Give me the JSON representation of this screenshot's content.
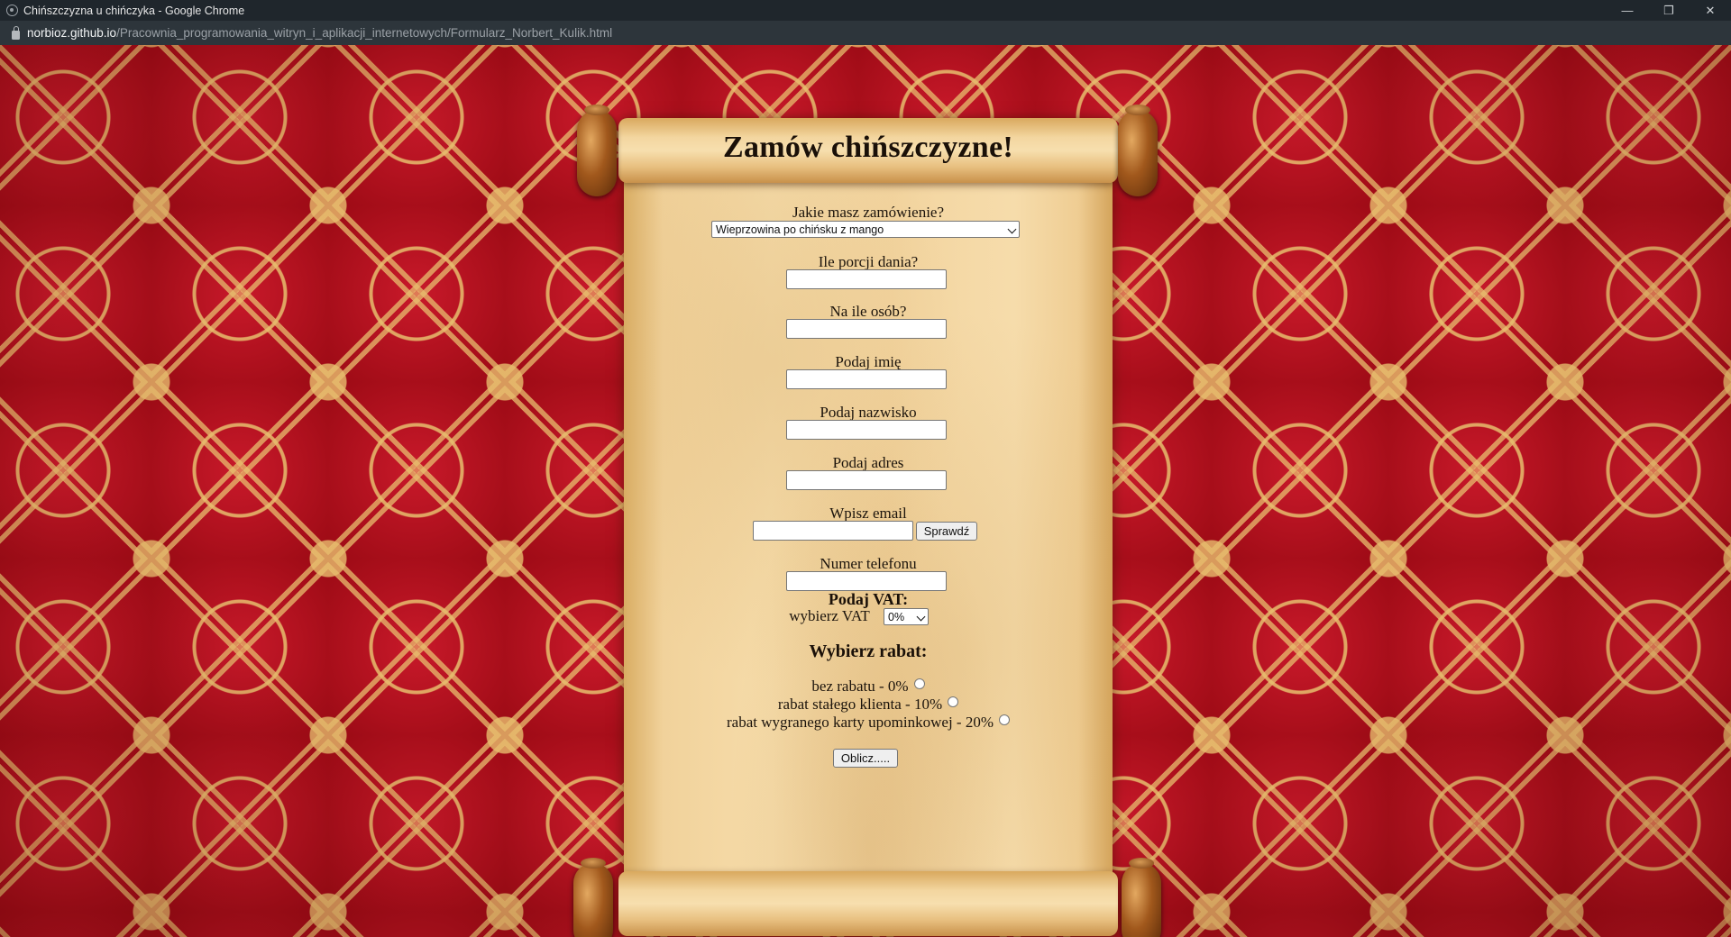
{
  "window": {
    "title": "Chińszczyzna u chińczyka - Google Chrome",
    "controls": {
      "minimize": "—",
      "restore": "❐",
      "close": "✕"
    }
  },
  "address": {
    "host": "norbioz.github.io",
    "path": "/Pracownia_programowania_witryn_i_aplikacji_internetowych/Formularz_Norbert_Kulik.html"
  },
  "form": {
    "title": "Zamów chińszczyzne!",
    "order_label": "Jakie masz zamówienie?",
    "order_selected": "Wieprzowina po chińsku z mango",
    "portions_label": "Ile porcji dania?",
    "persons_label": "Na ile osób?",
    "first_name_label": "Podaj imię",
    "last_name_label": "Podaj nazwisko",
    "address_label": "Podaj adres",
    "email_label": "Wpisz email",
    "email_check_button": "Sprawdź",
    "phone_label": "Numer telefonu",
    "vat_heading": "Podaj VAT:",
    "vat_label": "wybierz VAT",
    "vat_selected": "0%",
    "discount_heading": "Wybierz rabat:",
    "discounts": [
      {
        "label": "bez rabatu - 0%"
      },
      {
        "label": "rabat stałego klienta - 10%"
      },
      {
        "label": "rabat wygranego karty upominkowej - 20%"
      }
    ],
    "calculate_button": "Oblicz....."
  },
  "colors": {
    "wallpaper_red": "#b0101c",
    "wallpaper_gold": "#e8be6e",
    "parchment": "#f6dcaa",
    "knob_brown": "#a1581c"
  }
}
